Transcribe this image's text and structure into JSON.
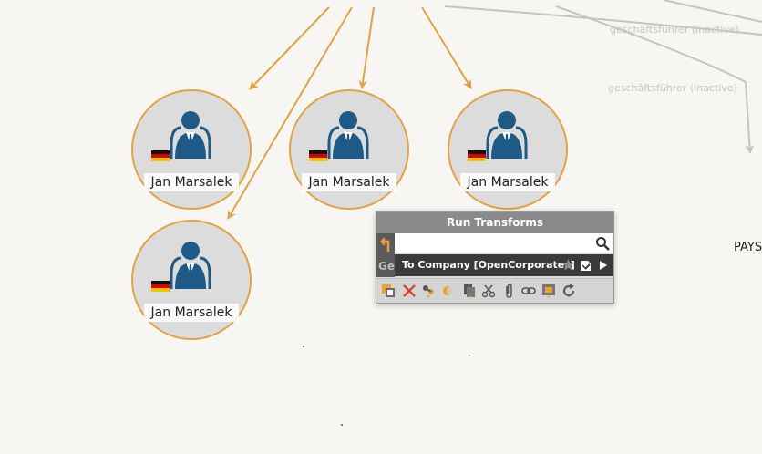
{
  "graph": {
    "nodes": [
      {
        "label": "Jan Marsalek",
        "icon": "person-icon",
        "flag": "germany-flag"
      },
      {
        "label": "Jan Marsalek",
        "icon": "person-icon",
        "flag": "germany-flag"
      },
      {
        "label": "Jan Marsalek",
        "icon": "person-icon",
        "flag": "germany-flag"
      },
      {
        "label": "Jan Marsalek",
        "icon": "person-icon",
        "flag": "germany-flag"
      }
    ],
    "edge_labels": [
      "geschäftsführer (inactive)",
      "geschäftsführer (inactive)"
    ],
    "side_text": "PAYS",
    "colors": {
      "edge_active": "#e0a444",
      "edge_inactive": "#c4c4c4",
      "node_fill": "#dddcdc",
      "person": "#1f5a86"
    }
  },
  "run_transforms": {
    "title": "Run Transforms",
    "search": {
      "value": "",
      "placeholder": ""
    },
    "group_label": "Ge",
    "transform_name": "To Company [OpenCorporates]",
    "toolbar_icons": [
      "select-icon",
      "delete-icon",
      "link-icon",
      "merge-icon",
      "copy-icon",
      "cut-icon",
      "attach-icon",
      "chain-icon",
      "frame-icon",
      "refresh-icon"
    ]
  }
}
